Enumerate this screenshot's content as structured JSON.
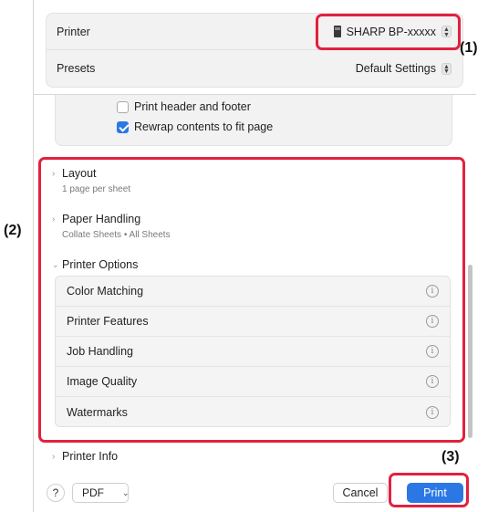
{
  "printer_row": {
    "label": "Printer",
    "value": "SHARP BP-xxxxx"
  },
  "presets_row": {
    "label": "Presets",
    "value": "Default Settings"
  },
  "checkboxes": [
    {
      "label": "Print header and footer",
      "checked": false
    },
    {
      "label": "Rewrap contents to fit page",
      "checked": true
    }
  ],
  "sections": {
    "layout": {
      "title": "Layout",
      "subtitle": "1 page per sheet"
    },
    "paper_handling": {
      "title": "Paper Handling",
      "subtitle": "Collate Sheets • All Sheets"
    },
    "printer_options": {
      "title": "Printer Options"
    },
    "printer_info": {
      "title": "Printer Info"
    }
  },
  "printer_options_items": [
    "Color Matching",
    "Printer Features",
    "Job Handling",
    "Image Quality",
    "Watermarks"
  ],
  "info_glyph": "i",
  "bottom_bar": {
    "help": "?",
    "pdf": "PDF",
    "cancel": "Cancel",
    "print": "Print"
  },
  "callouts": {
    "c1": "(1)",
    "c2": "(2)",
    "c3": "(3)"
  },
  "colors": {
    "accent": "#2b78e4",
    "highlight": "#e2213e"
  },
  "icons": {
    "printer": "printer-icon",
    "stepper": "up-down-stepper-icon",
    "chevron": "chevron-right-icon",
    "info": "info-icon",
    "caret": "chevron-down-icon"
  }
}
